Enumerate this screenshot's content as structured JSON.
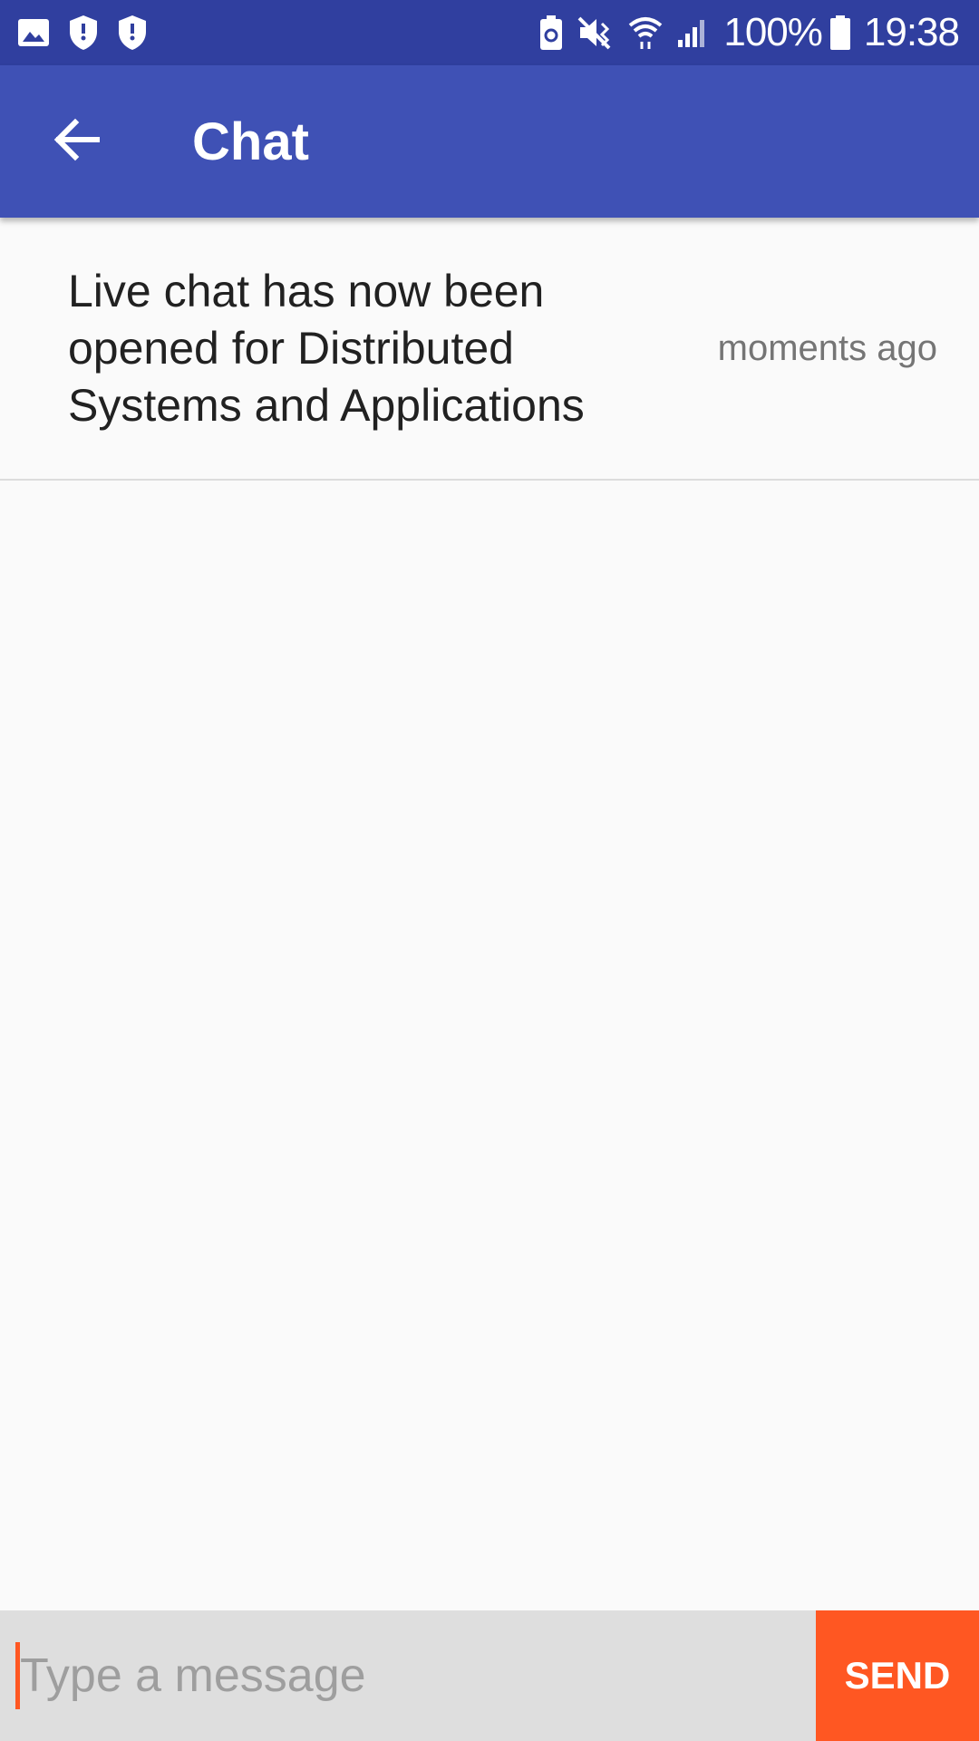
{
  "status_bar": {
    "left_icons": [
      "gallery-icon",
      "shield-icon",
      "shield-icon"
    ],
    "right_icons": [
      "battery-saver-icon",
      "mute-vibrate-icon",
      "wifi-icon",
      "signal-icon"
    ],
    "battery": "100%",
    "time": "19:38"
  },
  "app_bar": {
    "back_icon": "arrow-back-icon",
    "title": "Chat"
  },
  "messages": [
    {
      "text": "Live chat has now been opened for Distributed Systems and Applications",
      "time": "moments ago"
    }
  ],
  "composer": {
    "placeholder": "Type a message",
    "value": "",
    "send_label": "SEND"
  },
  "colors": {
    "status_bar": "#303f9f",
    "app_bar": "#3f51b5",
    "accent": "#ff5722",
    "composer_bg": "#dedede"
  }
}
